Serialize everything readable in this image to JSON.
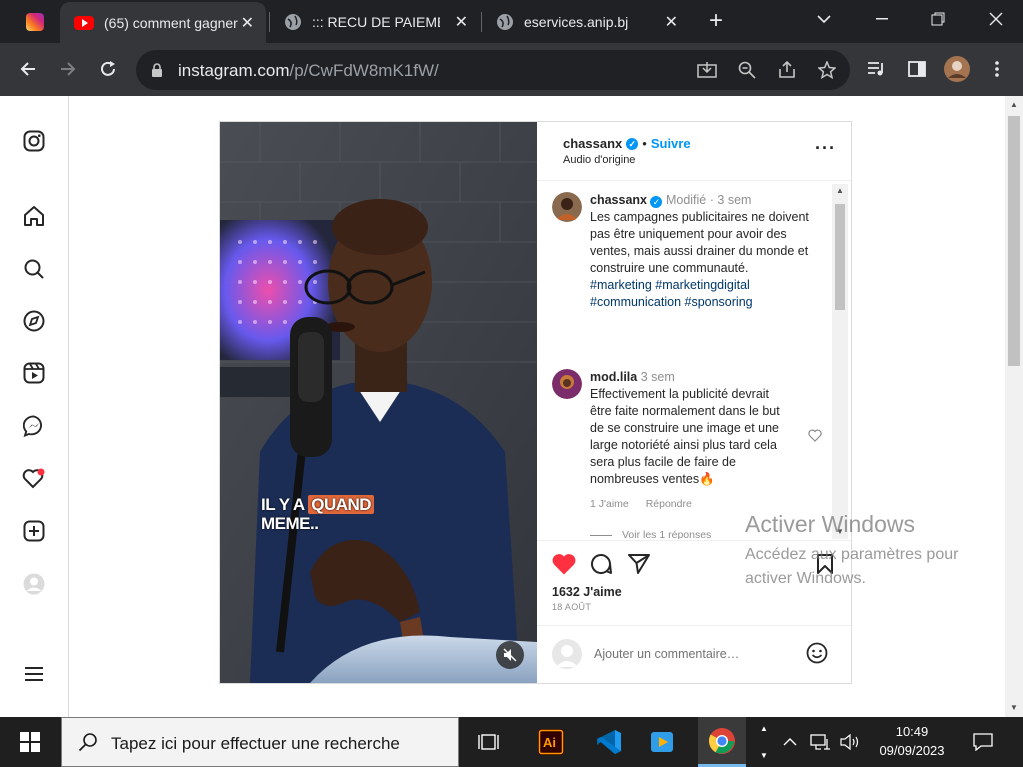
{
  "browser": {
    "tabs": [
      {
        "title": ""
      },
      {
        "title": "(65) comment gagner"
      },
      {
        "title": "::: RECU DE PAIEMENT"
      },
      {
        "title": "eservices.anip.bj"
      }
    ],
    "new_tab_label": "+",
    "url": {
      "host": "instagram.com",
      "path": "/p/CwFdW8mK1fW/"
    },
    "colors": {
      "tabbar": "#202124",
      "toolbar": "#35363a"
    }
  },
  "post": {
    "author": "chassanx",
    "follow_label": "Suivre",
    "separator": "•",
    "audio": "Audio d'origine",
    "video_caption": {
      "part1": "IL Y A",
      "highlight": "QUAND",
      "part2": "MEME.."
    },
    "caption": {
      "username": "chassanx",
      "edited": "Modifié",
      "dot": "·",
      "age": "3 sem",
      "text": "Les campagnes publicitaires ne doivent pas être uniquement pour avoir des ventes, mais aussi drainer du monde et construire une communauté.",
      "hashtags": "#marketing #marketingdigital #communication #sponsoring"
    },
    "comments": [
      {
        "username": "mod.lila",
        "age": "3 sem",
        "text": "Effectivement la publicité devrait être faite normalement dans le but de se construire une image et une large notoriété ainsi plus tard cela sera plus facile de faire de nombreuses ventes🔥",
        "likes_label": "1 J'aime",
        "reply_label": "Répondre",
        "view_replies": "Voir les 1 réponses"
      }
    ],
    "likes": "1632 J'aime",
    "date": "18 AOÛT",
    "comment_placeholder": "Ajouter un commentaire…",
    "like_color": "#ff3040"
  },
  "windows_watermark": {
    "title": "Activer Windows",
    "subtitle": "Accédez aux paramètres pour activer Windows."
  },
  "taskbar": {
    "search_placeholder": "Tapez ici pour effectuer une recherche",
    "time": "10:49",
    "date": "09/09/2023",
    "apps": [
      "task-view",
      "adobe-illustrator",
      "vscode",
      "video-editor",
      "chrome"
    ]
  }
}
